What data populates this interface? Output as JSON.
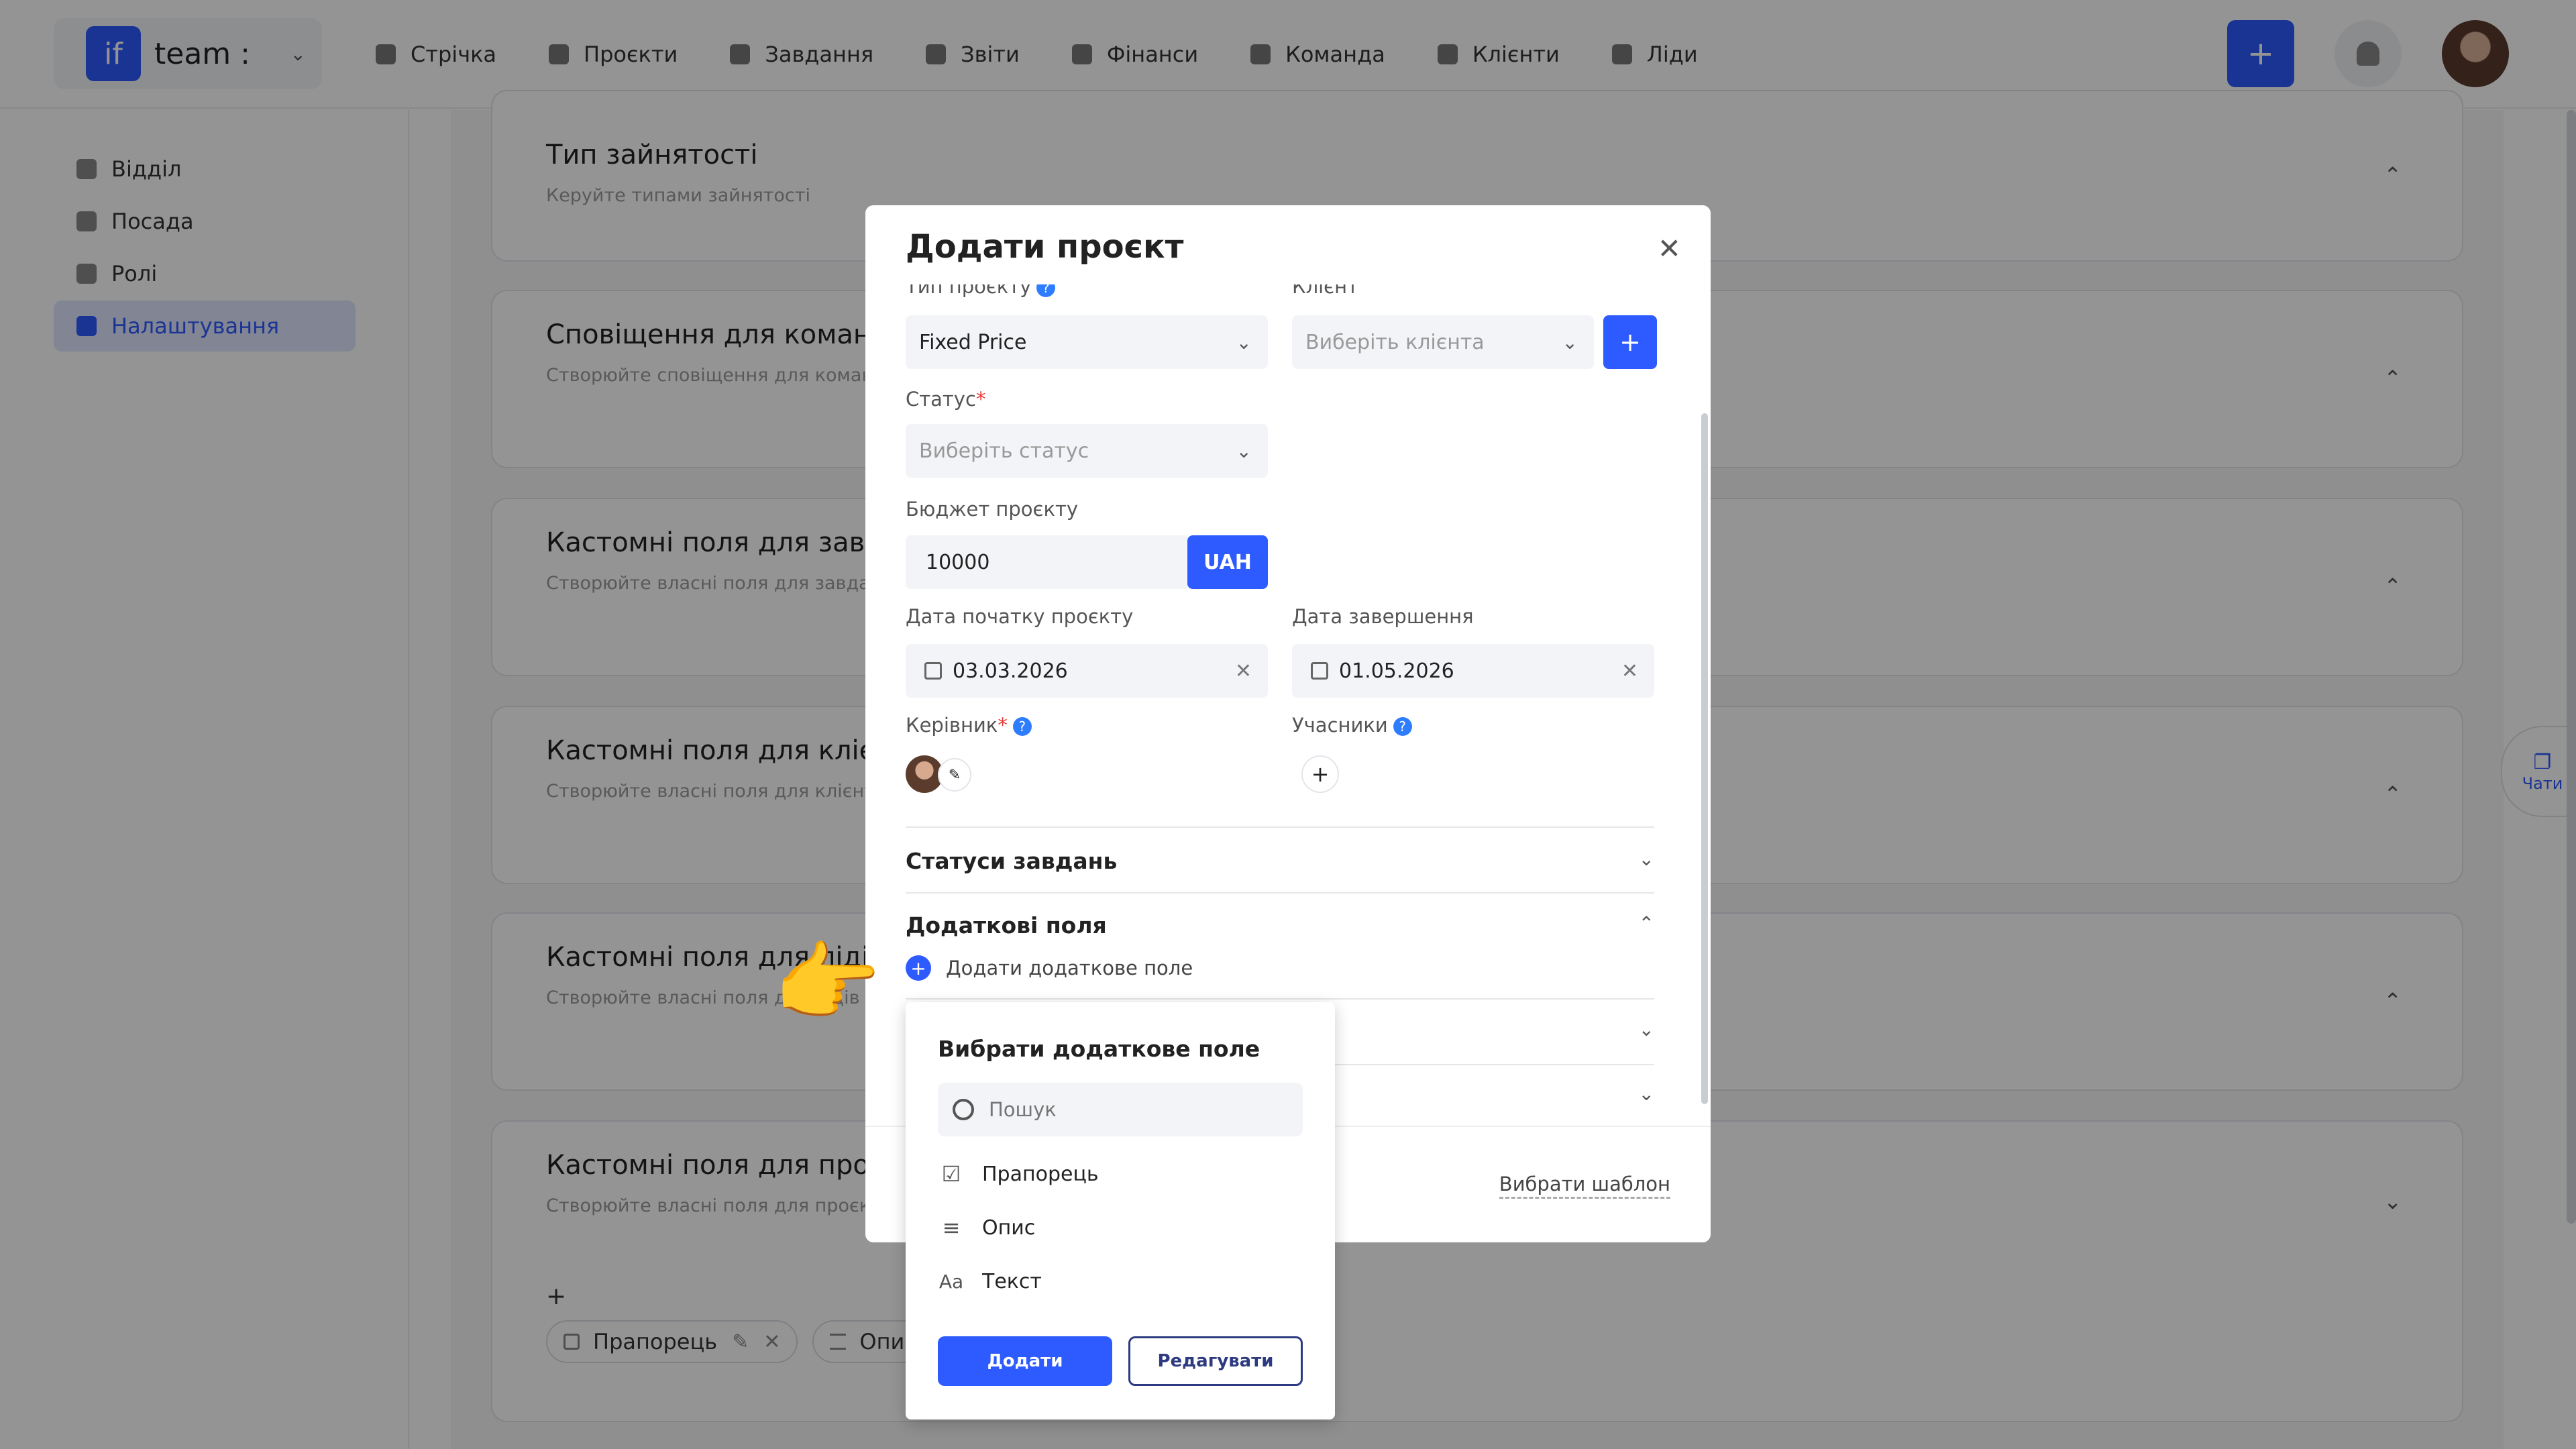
{
  "header": {
    "brand_logo": "if",
    "brand_name": "team :",
    "nav": [
      "Стрічка",
      "Проєкти",
      "Завдання",
      "Звіти",
      "Фінанси",
      "Команда",
      "Клієнти",
      "Ліди"
    ],
    "plus": "+"
  },
  "sidebar": {
    "items": [
      {
        "label": "Відділ"
      },
      {
        "label": "Посада"
      },
      {
        "label": "Ролі"
      },
      {
        "label": "Налаштування",
        "active": true
      }
    ]
  },
  "settings_cards": [
    {
      "title": "Тип зайнятості",
      "desc": "Керуйте типами зайнятості"
    },
    {
      "title": "Сповіщення для команди",
      "desc": "Створюйте сповіщення для команди"
    },
    {
      "title": "Кастомні поля для завдань",
      "desc": "Створюйте власні поля для завдань"
    },
    {
      "title": "Кастомні поля для клієнтів",
      "desc": "Створюйте власні поля для клієнтів"
    },
    {
      "title": "Кастомні поля для лідів",
      "desc": "Створюйте власні поля для лідів"
    },
    {
      "title": "Кастомні поля для проєктів",
      "desc": "Створюйте власні поля для проєктів"
    }
  ],
  "project_chips": [
    {
      "label": "Прапорець"
    },
    {
      "label": "Опис"
    }
  ],
  "chat": {
    "label": "Чати"
  },
  "modal": {
    "title": "Додати проєкт",
    "project_type": {
      "label": "Тип проєкту",
      "value": "Fixed Price"
    },
    "client": {
      "label": "Клієнт",
      "placeholder": "Виберіть клієнта"
    },
    "status": {
      "label": "Статус",
      "placeholder": "Виберіть статус"
    },
    "budget": {
      "label": "Бюджет проєкту",
      "value": "10000",
      "currency": "UAH"
    },
    "start_date": {
      "label": "Дата початку проєкту",
      "value": "03.03.2026"
    },
    "end_date": {
      "label": "Дата завершення",
      "value": "01.05.2026"
    },
    "manager": {
      "label": "Керівник"
    },
    "participants": {
      "label": "Учасники"
    },
    "task_statuses": "Статуси завдань",
    "extra_fields": "Додаткові поля",
    "add_extra_field": "Додати додаткове поле",
    "choose_template": "Вибрати шаблон"
  },
  "popup": {
    "title": "Вибрати додаткове поле",
    "search_placeholder": "Пошук",
    "options": [
      {
        "label": "Прапорець",
        "icon": "checkbox-icon"
      },
      {
        "label": "Опис",
        "icon": "lines-icon"
      },
      {
        "label": "Текст",
        "icon": "text-icon"
      }
    ],
    "add_button": "Додати",
    "edit_button": "Редагувати"
  },
  "colors": {
    "accent": "#2e5bff",
    "overlay": "rgba(0,0,0,0.42)"
  }
}
